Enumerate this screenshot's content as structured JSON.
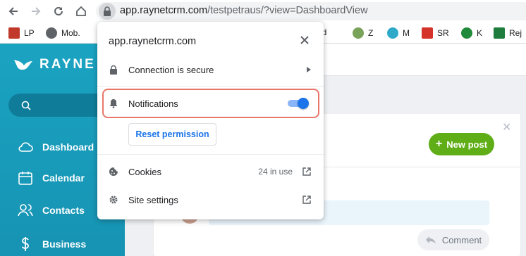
{
  "browser": {
    "url_host": "app.raynetcrm.com",
    "url_path": "/testpetraus/?view=DashboardView",
    "bookmarks": [
      {
        "label": "LP",
        "icon": "lp-icon",
        "color": "#c0392b"
      },
      {
        "label": "Mob.",
        "icon": "globe-icon",
        "color": "#5f6368"
      },
      {
        "label": "Pod",
        "icon": "pod-icon",
        "color": "#4a7bd1"
      },
      {
        "label": "Z",
        "icon": "z-icon",
        "color": "#7aa35a"
      },
      {
        "label": "M",
        "icon": "m-icon",
        "color": "#2fa9c9"
      },
      {
        "label": "SR",
        "icon": "sr-icon",
        "color": "#d6322c"
      },
      {
        "label": "K",
        "icon": "k-icon",
        "color": "#1f8a3a"
      },
      {
        "label": "Rej",
        "icon": "rej-icon",
        "color": "#1e7d3c"
      }
    ]
  },
  "site_info": {
    "host": "app.raynetcrm.com",
    "connection": "Connection is secure",
    "notifications": "Notifications",
    "notifications_enabled": true,
    "reset_permission": "Reset permission",
    "cookies": "Cookies",
    "cookies_in_use": "24 in use",
    "site_settings": "Site settings"
  },
  "app": {
    "brand": "RAYNE",
    "nav": [
      {
        "label": "Dashboard",
        "icon": "cloud-icon"
      },
      {
        "label": "Calendar",
        "icon": "calendar-icon"
      },
      {
        "label": "Contacts",
        "icon": "contacts-icon"
      },
      {
        "label": "Business",
        "icon": "dollar-icon"
      }
    ],
    "new_post": "New post",
    "comment": "Comment"
  },
  "colors": {
    "accent": "#1a73e8",
    "sidebar": "#1aa3c1",
    "new_post": "#5fae17",
    "highlight": "#e8776a"
  }
}
